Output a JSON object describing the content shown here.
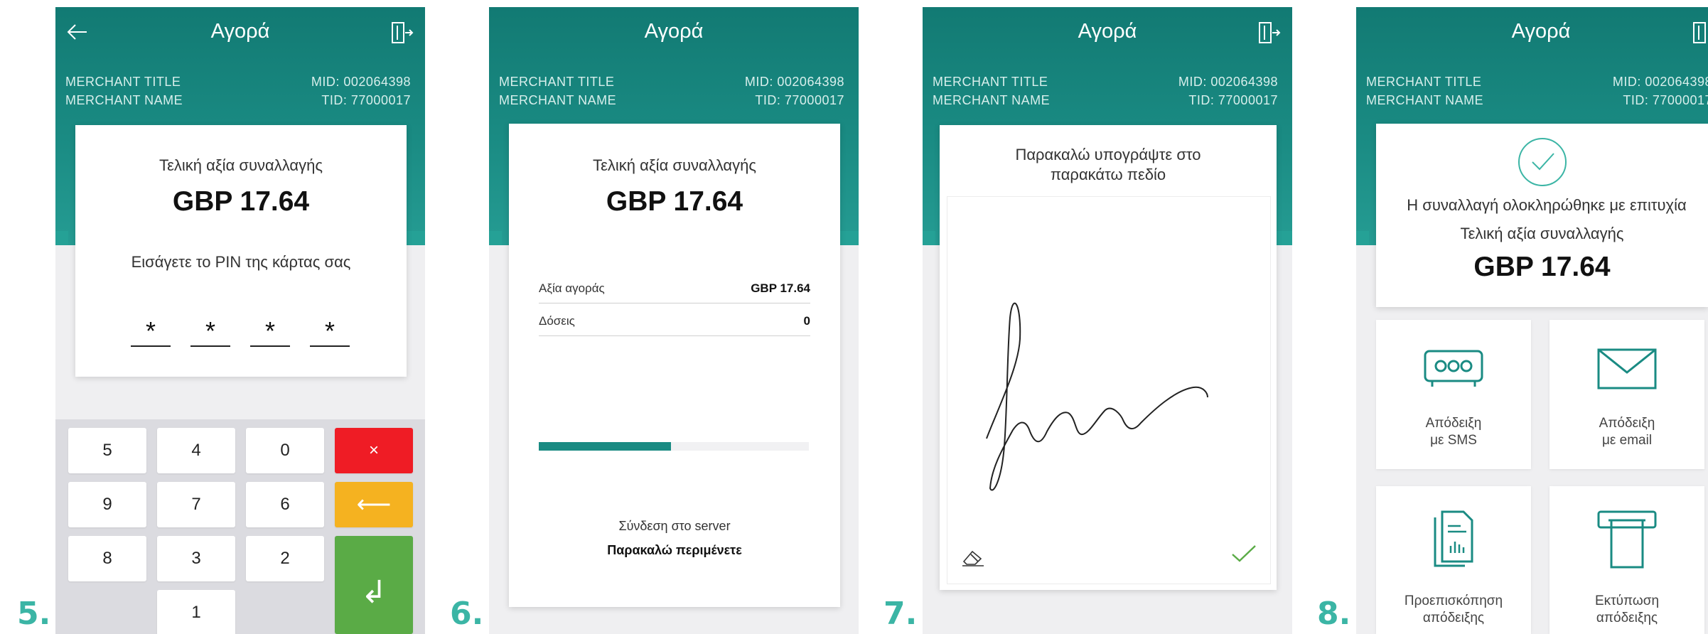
{
  "step_numbers": [
    "5.",
    "6.",
    "7.",
    "8."
  ],
  "colors": {
    "teal": "#1a8b83",
    "accent": "#3bb5a5",
    "red": "#ef1c25",
    "orange": "#f5b220",
    "green": "#5aab46"
  },
  "common": {
    "title": "Αγορά",
    "merchant_title": "MERCHANT TITLE",
    "merchant_name": "MERCHANT NAME",
    "mid": "MID: 002064398",
    "tid": "TID: 77000017"
  },
  "screen5": {
    "label": "Τελική αξία συναλλαγής",
    "amount": "GBP 17.64",
    "pin_prompt": "Εισάγετε το PIN της κάρτας σας",
    "pin_digits": [
      "*",
      "*",
      "*",
      "*"
    ],
    "keys": {
      "k5": "5",
      "k4": "4",
      "k0": "0",
      "cancel": "×",
      "k9": "9",
      "k7": "7",
      "k6": "6",
      "backspace": "⟵",
      "k8": "8",
      "k3": "3",
      "k2": "2",
      "enter": "↲",
      "k1": "1"
    }
  },
  "screen6": {
    "label": "Τελική αξία συναλλαγής",
    "amount": "GBP 17.64",
    "rows": [
      {
        "label": "Αξία αγοράς",
        "value": "GBP 17.64"
      },
      {
        "label": "Δόσεις",
        "value": "0"
      }
    ],
    "progress": 0.49,
    "status": "Σύνδεση στο server",
    "wait": "Παρακαλώ περιμένετε"
  },
  "screen7": {
    "prompt_line1": "Παρακαλώ υπογράψτε στο",
    "prompt_line2": "παρακάτω πεδίο"
  },
  "screen8": {
    "success": "Η συναλλαγή ολοκληρώθηκε με επιτυχία",
    "label": "Τελική αξία συναλλαγής",
    "amount": "GBP 17.64",
    "tiles": [
      {
        "line1": "Απόδειξη",
        "line2": "με SMS"
      },
      {
        "line1": "Απόδειξη",
        "line2": "με email"
      },
      {
        "line1": "Προεπισκόπηση",
        "line2": "απόδειξης"
      },
      {
        "line1": "Εκτύπωση",
        "line2": "απόδειξης"
      }
    ]
  }
}
